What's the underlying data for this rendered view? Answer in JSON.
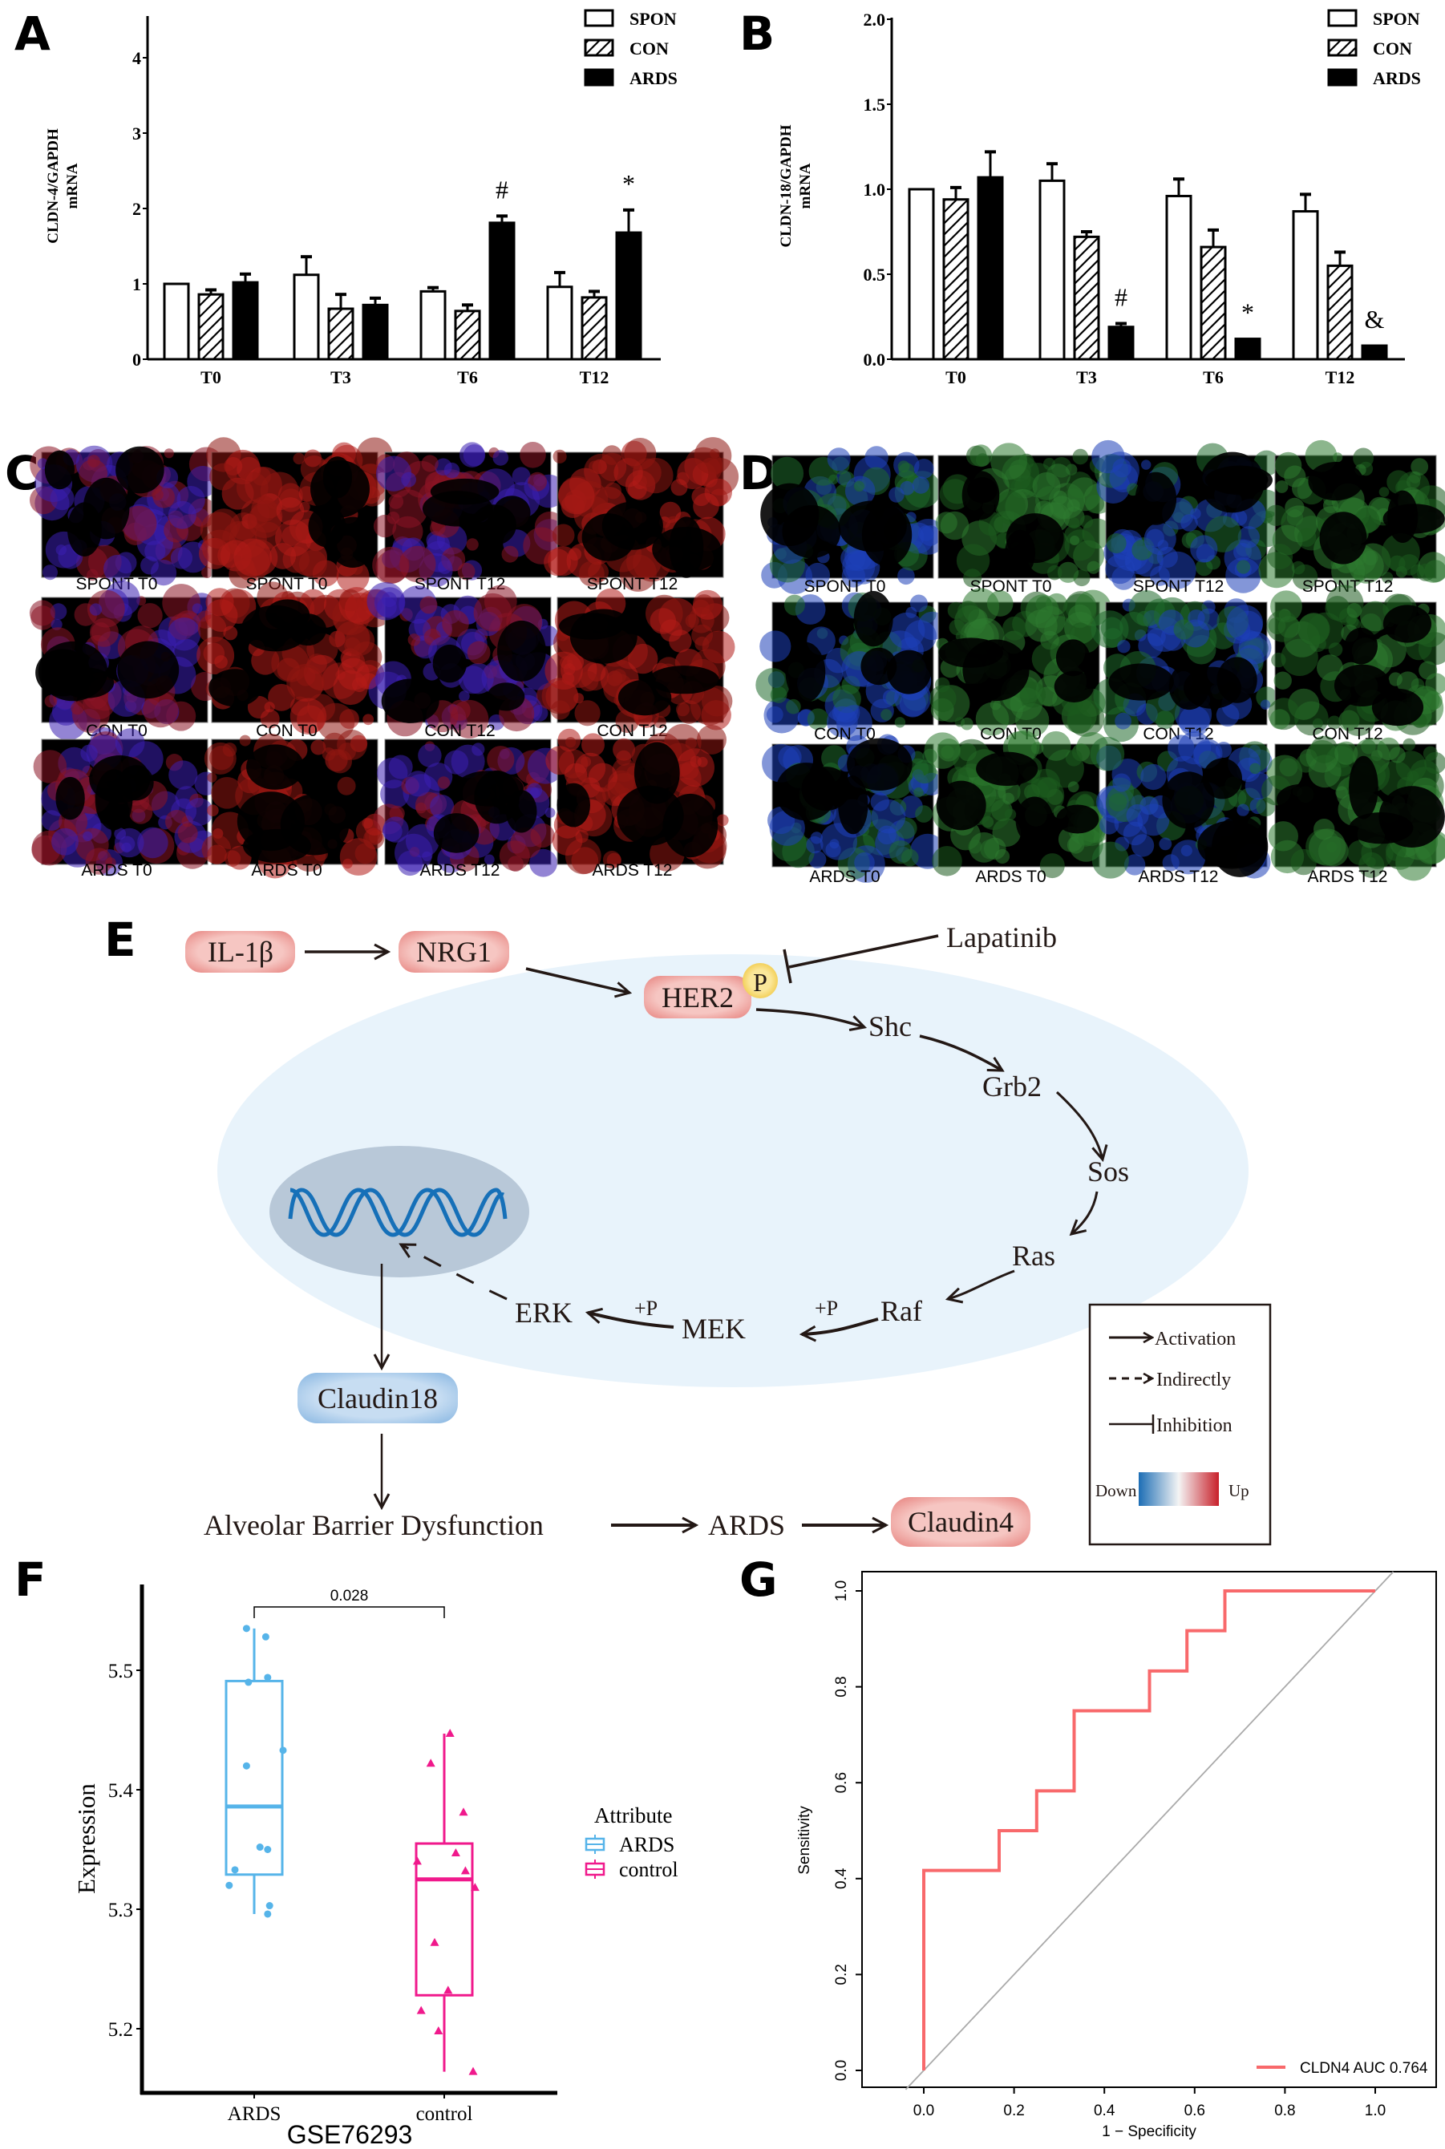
{
  "figure": {
    "panels": {
      "A": "A",
      "B": "B",
      "C": "C",
      "D": "D",
      "E": "E",
      "F": "F",
      "G": "G"
    }
  },
  "chart_data": [
    {
      "id": "A",
      "type": "bar",
      "title": "",
      "ylabel_line1": "CLDN-4/GAPDH",
      "ylabel_line2": "mRNA",
      "xlabel": "",
      "categories": [
        "T0",
        "T3",
        "T6",
        "T12"
      ],
      "ylim": [
        0,
        4.5
      ],
      "yticks": [
        "0",
        "1",
        "2",
        "3",
        "4"
      ],
      "ytick_values": [
        0,
        1,
        2,
        3,
        4
      ],
      "legend": [
        "SPON",
        "CON",
        "ARDS"
      ],
      "legend_position": "top-right",
      "series": [
        {
          "name": "SPON",
          "style": "open",
          "values": [
            1.0,
            1.12,
            0.9,
            0.96
          ],
          "error": [
            0.0,
            0.24,
            0.05,
            0.19
          ]
        },
        {
          "name": "CON",
          "style": "hatched",
          "values": [
            0.86,
            0.67,
            0.64,
            0.82
          ],
          "error": [
            0.06,
            0.19,
            0.08,
            0.08
          ]
        },
        {
          "name": "ARDS",
          "style": "filled",
          "values": [
            1.02,
            0.72,
            1.81,
            1.68
          ],
          "error": [
            0.11,
            0.09,
            0.09,
            0.3
          ]
        }
      ],
      "annotations": [
        {
          "category": "T6",
          "series": "ARDS",
          "text": "#"
        },
        {
          "category": "T12",
          "series": "ARDS",
          "text": "*"
        }
      ]
    },
    {
      "id": "B",
      "type": "bar",
      "title": "",
      "ylabel_line1": "CLDN-18/GAPDH",
      "ylabel_line2": "mRNA",
      "xlabel": "",
      "categories": [
        "T0",
        "T3",
        "T6",
        "T12"
      ],
      "ylim": [
        0,
        2.0
      ],
      "yticks": [
        "0.0",
        "0.5",
        "1.0",
        "1.5",
        "2.0"
      ],
      "ytick_values": [
        0,
        0.5,
        1.0,
        1.5,
        2.0
      ],
      "legend": [
        "SPON",
        "CON",
        "ARDS"
      ],
      "legend_position": "top-right",
      "series": [
        {
          "name": "SPON",
          "style": "open",
          "values": [
            1.0,
            1.05,
            0.96,
            0.87
          ],
          "error": [
            0.0,
            0.1,
            0.1,
            0.1
          ]
        },
        {
          "name": "CON",
          "style": "hatched",
          "values": [
            0.94,
            0.72,
            0.66,
            0.55
          ],
          "error": [
            0.07,
            0.03,
            0.1,
            0.08
          ]
        },
        {
          "name": "ARDS",
          "style": "filled",
          "values": [
            1.07,
            0.19,
            0.12,
            0.08
          ],
          "error": [
            0.15,
            0.02,
            0.0,
            0.0
          ]
        }
      ],
      "annotations": [
        {
          "category": "T3",
          "series": "ARDS",
          "text": "#"
        },
        {
          "category": "T6",
          "series": "ARDS",
          "text": "*"
        },
        {
          "category": "T12",
          "series": "ARDS",
          "text": "&"
        }
      ]
    },
    {
      "id": "F",
      "type": "box",
      "title": "",
      "xlabel": "GSE76293",
      "ylabel": "Expression",
      "categories": [
        "ARDS",
        "control"
      ],
      "ylim": [
        5.145,
        5.57
      ],
      "yticks": [
        "5.2",
        "5.3",
        "5.4",
        "5.5"
      ],
      "ytick_values": [
        5.2,
        5.3,
        5.4,
        5.5
      ],
      "legend_title": "Attribute",
      "legend": [
        "ARDS",
        "control"
      ],
      "legend_position": "right",
      "colors": {
        "ARDS": "#56B4E9",
        "control": "#F0198C"
      },
      "comparison": {
        "groups": [
          "ARDS",
          "control"
        ],
        "p_value": "0.028"
      },
      "boxes": [
        {
          "name": "ARDS",
          "whisker_low": 5.296,
          "q1": 5.329,
          "median": 5.386,
          "q3": 5.491,
          "whisker_high": 5.535,
          "points": [
            [
              -0.04,
              5.535
            ],
            [
              0.06,
              5.528
            ],
            [
              0.07,
              5.494
            ],
            [
              -0.03,
              5.49
            ],
            [
              0.15,
              5.433
            ],
            [
              -0.04,
              5.42
            ],
            [
              0.03,
              5.352
            ],
            [
              0.07,
              5.35
            ],
            [
              -0.1,
              5.333
            ],
            [
              -0.13,
              5.32
            ],
            [
              0.08,
              5.303
            ],
            [
              0.07,
              5.296
            ]
          ]
        },
        {
          "name": "control",
          "whisker_low": 5.164,
          "q1": 5.228,
          "median": 5.325,
          "q3": 5.355,
          "whisker_high": 5.447,
          "points": [
            [
              0.03,
              5.447
            ],
            [
              -0.07,
              5.422
            ],
            [
              0.1,
              5.381
            ],
            [
              0.06,
              5.347
            ],
            [
              -0.14,
              5.34
            ],
            [
              0.11,
              5.332
            ],
            [
              0.16,
              5.318
            ],
            [
              -0.05,
              5.272
            ],
            [
              0.02,
              5.232
            ],
            [
              -0.12,
              5.215
            ],
            [
              -0.03,
              5.198
            ],
            [
              0.15,
              5.164
            ]
          ]
        }
      ]
    },
    {
      "id": "G",
      "type": "line",
      "title": "",
      "xlabel": "1 − Specificity",
      "ylabel": "Sensitivity",
      "xlim": [
        -0.13,
        1.13
      ],
      "ylim": [
        -0.04,
        1.04
      ],
      "xticks": [
        "0.0",
        "0.2",
        "0.4",
        "0.6",
        "0.8",
        "1.0"
      ],
      "yticks": [
        "0.0",
        "0.2",
        "0.4",
        "0.6",
        "0.8",
        "1.0"
      ],
      "tick_values": [
        0,
        0.2,
        0.4,
        0.6,
        0.8,
        1.0
      ],
      "legend_position": "bottom-right",
      "series": [
        {
          "name": "CLDN4 AUC 0.764",
          "color": "#F8696B",
          "x": [
            0,
            0,
            0.167,
            0.167,
            0.25,
            0.25,
            0.333,
            0.333,
            0.5,
            0.5,
            0.583,
            0.583,
            0.667,
            0.667,
            1.0
          ],
          "y": [
            0,
            0.417,
            0.417,
            0.5,
            0.5,
            0.583,
            0.583,
            0.75,
            0.75,
            0.833,
            0.833,
            0.917,
            0.917,
            1.0,
            1.0
          ]
        },
        {
          "name": "reference",
          "color": "#AAAAAA",
          "x": [
            -0.04,
            1.04
          ],
          "y": [
            -0.04,
            1.04
          ]
        }
      ],
      "auc": "0.764"
    }
  ],
  "micrographs": {
    "C": {
      "stain": "red",
      "labels": [
        [
          "SPONT  T0",
          "SPONT  T0",
          "SPONT  T12",
          "SPONT  T12"
        ],
        [
          "CON  T0",
          "CON  T0",
          "CON  T12",
          "CON  T12"
        ],
        [
          "ARDS  T0",
          "ARDS  T0",
          "ARDS  T12",
          "ARDS  T12"
        ]
      ],
      "merged_columns": [
        true,
        false,
        true,
        false
      ]
    },
    "D": {
      "stain": "green",
      "labels": [
        [
          "SPONT  T0",
          "SPONT  T0",
          "SPONT  T12",
          "SPONT  T12"
        ],
        [
          "CON  T0",
          "CON  T0",
          "CON  T12",
          "CON  T12"
        ],
        [
          "ARDS  T0",
          "ARDS  T0",
          "ARDS  T12",
          "ARDS  T12"
        ]
      ],
      "merged_columns": [
        true,
        false,
        true,
        false
      ]
    }
  },
  "pathway": {
    "nodes": {
      "il1b": "IL-1β",
      "nrg1": "NRG1",
      "her2": "HER2",
      "p": "P",
      "lapatinib": "Lapatinib",
      "shc": "Shc",
      "grb2": "Grb2",
      "sos": "Sos",
      "ras": "Ras",
      "raf": "Raf",
      "mek": "MEK",
      "erk": "ERK",
      "plus_p_1": "+P",
      "plus_p_2": "+P",
      "claudin18": "Claudin18",
      "barrier": "Alveolar Barrier Dysfunction",
      "ards": "ARDS",
      "claudin4": "Claudin4"
    },
    "legend": {
      "activation": "Activation",
      "indirectly": "Indirectly",
      "inhibition": "Inhibition",
      "down": "Down",
      "up": "Up"
    },
    "colors": {
      "upregulated": "#F0A0A0",
      "downregulated": "#A8CCEC",
      "cell": "#E8F3FB",
      "nucleus": "#B8C8D8",
      "dna": "#1670B8",
      "phospho": "#F5D76E"
    }
  }
}
